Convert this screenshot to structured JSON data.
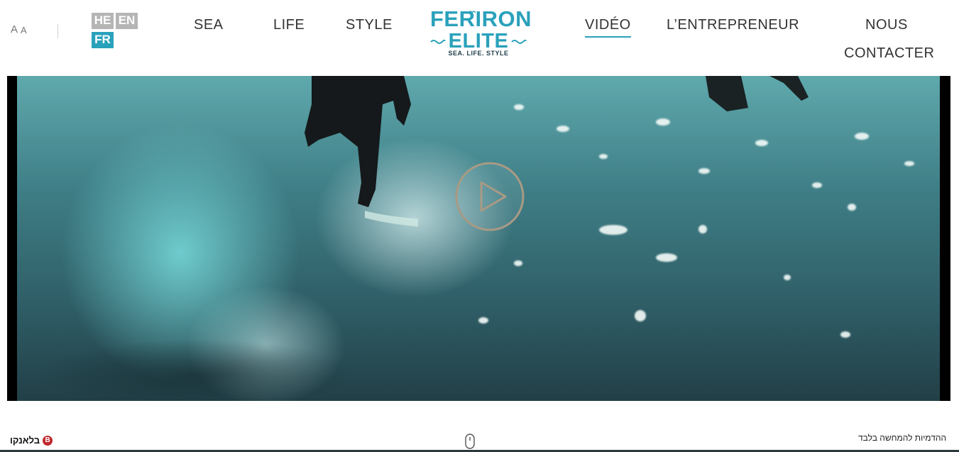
{
  "header": {
    "font_size_small": "A",
    "font_size_large": "A",
    "languages": {
      "he": "HE",
      "en": "EN",
      "fr": "FR"
    },
    "nav": {
      "sea": "SEA",
      "life": "LIFE",
      "style": "STYLE",
      "video": "VIDÉO",
      "entrepreneur": "L’ENTREPRENEUR",
      "nous": "NOUS",
      "contacter": "CONTACTER"
    },
    "logo": {
      "line1": "FERIRON",
      "line2": "ELITE",
      "tagline": "SEA. LIFE. STYLE"
    }
  },
  "video": {
    "play_icon": "play-icon"
  },
  "footer": {
    "brand": "בלאנקו",
    "brand_badge": "B",
    "disclaimer": "ההדמיות להמחשה בלבד",
    "scroll_icon": "mouse-scroll-icon"
  },
  "colors": {
    "accent": "#2aa1bb",
    "lang_inactive": "#b5b5b5",
    "brand_red": "#c0282d"
  }
}
